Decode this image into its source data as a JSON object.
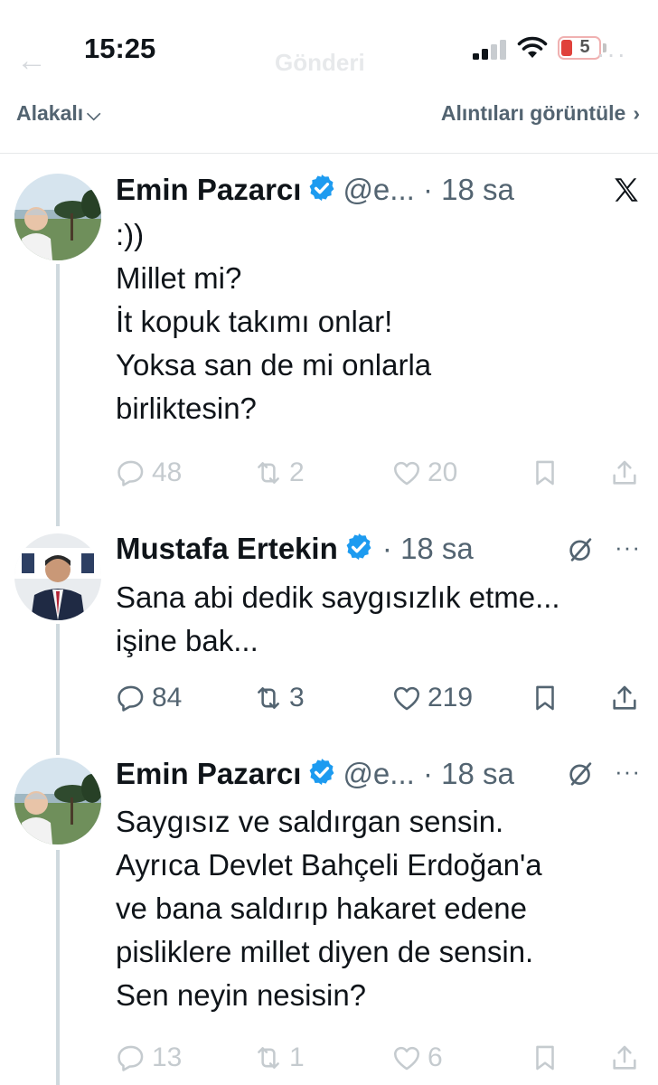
{
  "status_bar": {
    "time": "15:25",
    "battery_level": "5",
    "nav_title": "Gönderi"
  },
  "filter": {
    "sort_label": "Alakalı",
    "quotes_link": "Alıntıları görüntüle"
  },
  "tweets": [
    {
      "author_name": "Emin Pazarcı",
      "handle": "@e...",
      "time": "18 sa",
      "lines": [
        ":))",
        "Millet mi?",
        "İt kopuk takımı onlar!",
        "Yoksa san de mi onlarla",
        "birliktesin?"
      ],
      "replies": "48",
      "retweets": "2",
      "likes": "20"
    },
    {
      "author_name": "Mustafa Ertekin",
      "handle": "",
      "time": "18 sa",
      "lines": [
        "Sana abi dedik saygısızlık etme...",
        "işine bak..."
      ],
      "replies": "84",
      "retweets": "3",
      "likes": "219"
    },
    {
      "author_name": "Emin Pazarcı",
      "handle": "@e...",
      "time": "18 sa",
      "lines": [
        "Saygısız ve saldırgan sensin.",
        "Ayrıca Devlet Bahçeli Erdoğan'a",
        "ve bana saldırıp hakaret edene",
        "pisliklere millet diyen de sensin.",
        "Sen neyin nesisin?"
      ],
      "replies": "13",
      "retweets": "1",
      "likes": "6"
    }
  ],
  "icons": {
    "verified": "verified-badge-icon",
    "reply": "reply-icon",
    "retweet": "retweet-icon",
    "like": "heart-icon",
    "bookmark": "bookmark-icon",
    "share": "share-icon",
    "x_logo": "x-logo-icon",
    "grok": "grok-icon",
    "more": "more-icon"
  },
  "colors": {
    "verified": "#1d9bf0",
    "secondary_text": "#536471",
    "thread_line": "#cfd9de"
  }
}
